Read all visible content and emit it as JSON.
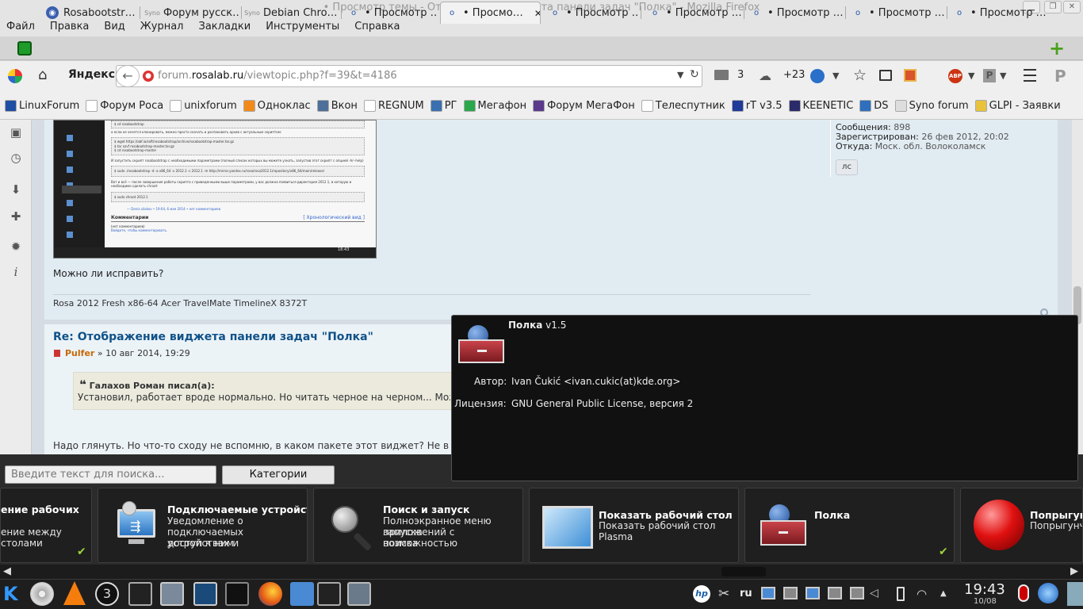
{
  "window": {
    "title": "• Просмотр темы - Отображение виджета панели задач \"Полка\" - Mozilla Firefox"
  },
  "menu": [
    "Файл",
    "Правка",
    "Вид",
    "Журнал",
    "Закладки",
    "Инструменты",
    "Справка"
  ],
  "tabs": [
    {
      "label": "Rosabootstr…",
      "icon": "rosa-icon"
    },
    {
      "label": "Форум русск…",
      "icon": "syno-icon"
    },
    {
      "label": "Debian Chro…",
      "icon": "syno-icon"
    },
    {
      "label": "• Просмотр …",
      "icon": "forum-icon"
    },
    {
      "label": "• Просмо…",
      "icon": "forum-icon",
      "active": true,
      "close": "✕"
    },
    {
      "label": "• Просмотр …",
      "icon": "forum-icon"
    },
    {
      "label": "• Просмотр …",
      "icon": "forum-icon"
    },
    {
      "label": "• Просмотр …",
      "icon": "forum-icon"
    },
    {
      "label": "• Просмотр …",
      "icon": "forum-icon"
    },
    {
      "label": "• Просмотр …",
      "icon": "forum-icon"
    }
  ],
  "nav": {
    "yandex": "Яндекс",
    "url_prefix": "forum.",
    "url_host": "rosalab.ru",
    "url_path": "/viewtopic.php?f=39&t=4186",
    "mail_count": "3",
    "weather": "+23"
  },
  "bookmarks": [
    {
      "label": "LinuxForum",
      "color": "#1f4fa3"
    },
    {
      "label": "Форум Роса",
      "color": "#ffffff"
    },
    {
      "label": "unixforum",
      "color": "#ffffff"
    },
    {
      "label": "Одноклас",
      "color": "#f28a1a"
    },
    {
      "label": "Вкон",
      "color": "#4d6f9a"
    },
    {
      "label": "REGNUM",
      "color": "#ffffff"
    },
    {
      "label": "РГ",
      "color": "#3a6fb0"
    },
    {
      "label": "Мегафон",
      "color": "#2aa84a"
    },
    {
      "label": "Форум МегаФон",
      "color": "#5b3a8c"
    },
    {
      "label": "Телеспутник",
      "color": "#ffffff"
    },
    {
      "label": "rT v3.5",
      "color": "#1f3a9a"
    },
    {
      "label": "KEENETIC",
      "color": "#2b2b6a"
    },
    {
      "label": "DS",
      "color": "#2f6fbd"
    },
    {
      "label": "Syno forum",
      "color": "#dddddd"
    },
    {
      "label": "GLPI - Заявки",
      "color": "#e8c23a"
    }
  ],
  "profile": {
    "messages_label": "Сообщения:",
    "messages": "898",
    "reg_label": "Зарегистрирован:",
    "reg": "26 фев 2012, 20:02",
    "from_label": "Откуда:",
    "from": "Моск. обл. Волоколамск",
    "pm": "лс"
  },
  "screenshot_content": {
    "lines": [
      "$ cd rosabootstrap",
      "а если не хочется клонировать, можно просто скачать и распаковать архив с актуальным скриптом:",
      "$ wget https://abf.io/soft/rosabootstrap/archive/rosabootstrap-master.tar.gz",
      "$ tar xzvf rosabootstrap-master.tar.gz",
      "$ cd rosabootstrap-master",
      "И запустить скрипт rosabootstrap с необходимыми параметрами (полный список которых вы можете узнать, запустив этот скрипт с опцией -h/--help)",
      "$ sudo ./rosabootstrap -d -a x86_64 -v 2012.1 -c 2012.1 -m http://mirror.yandex.ru/rosa/rosa2012.1/repository/x86_64/main/release/",
      "Вот и всё — после завершения работы скрипта с приведенными выше параметрами, у вас должна появиться директория 2012.1, в которую и необходимо сделать chroot:",
      "$ sudo chroot 2012.1",
      "— Denis.silakov • 19:04, 6 мая 2014 • нет комментариев",
      "Комментарии",
      "[ Хронологический вид ]",
      "(нет комментариев)",
      "Войдите, чтобы комментировать."
    ],
    "clock": "18:43"
  },
  "post1": {
    "question": "Можно ли исправить?",
    "signature": "Rosa 2012 Fresh x86-64 Acer TravelMate TimelineX 8372T"
  },
  "post2": {
    "title": "Re: Отображение виджета панели задач \"Полка\"",
    "author": "Pulfer",
    "date": "» 10 авг 2014, 19:29",
    "quote_author": "Галахов Роман писал(а):",
    "quote_text": "Установил, работает вроде нормально. Но читать черное на черном... Можно ли ис",
    "reply": "Надо глянуть. Но что-то сходу не вспомню, в каком пакете этот виджет? Не вижу"
  },
  "tooltip": {
    "name": "Полка",
    "version": "v1.5",
    "author_label": "Автор:",
    "author": "Ivan Čukić <ivan.cukic(at)kde.org>",
    "license_label": "Лицензия:",
    "license": "GNU General Public License, версия 2"
  },
  "widgets": {
    "search_placeholder": "Введите текст для поиска...",
    "categories": "Категории",
    "cards": [
      {
        "title": "ение рабочих",
        "desc1": "ение между",
        "desc2": "столами",
        "desc3": "",
        "check": "✔"
      },
      {
        "title": "Подключаемые устройства",
        "desc1": "Уведомление о",
        "desc2": "подключаемых устройствах и",
        "desc3": "доступ к ним"
      },
      {
        "title": "Поиск и запуск",
        "desc1": "Полноэкранное меню запуска",
        "desc2": "приложений с возможностью",
        "desc3": "поиска"
      },
      {
        "title": "Показать рабочий стол",
        "desc1": "Показать рабочий стол",
        "desc2": "Plasma",
        "desc3": ""
      },
      {
        "title": "Полка",
        "desc1": "",
        "desc2": "",
        "desc3": "",
        "check": "✔"
      },
      {
        "title": "Попрыгунч",
        "desc1": "Попрыгунч",
        "desc2": "",
        "desc3": ""
      }
    ]
  },
  "tray": {
    "lang": "ru",
    "time": "19:43",
    "date": "10/08"
  }
}
